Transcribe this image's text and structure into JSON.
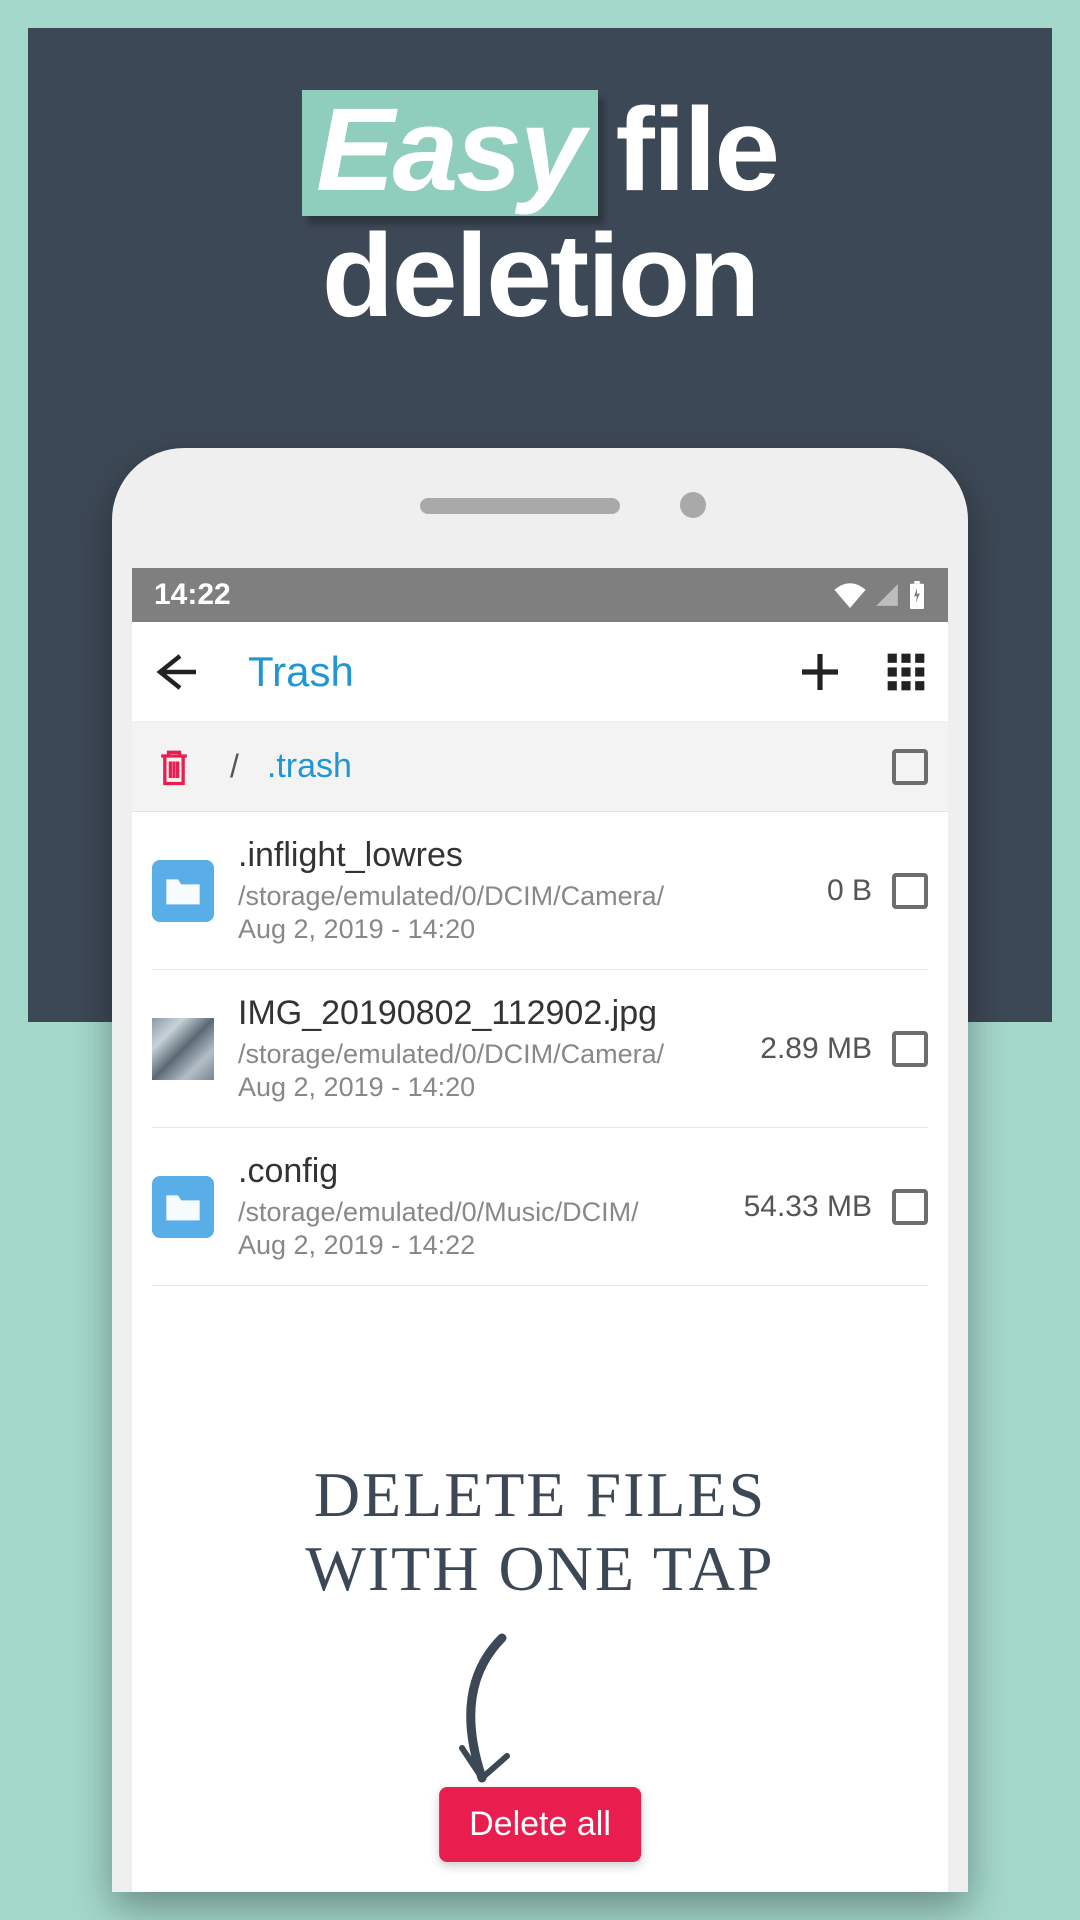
{
  "promo": {
    "headline_easy": "Easy",
    "headline_file": "file",
    "headline_deletion": "deletion",
    "callout_line1": "DELETE FILES",
    "callout_line2": "WITH ONE TAP"
  },
  "status": {
    "time": "14:22"
  },
  "appbar": {
    "title": "Trash"
  },
  "breadcrumb": {
    "separator": "/",
    "folder": ".trash"
  },
  "files": [
    {
      "name": ".inflight_lowres",
      "path": "/storage/emulated/0/DCIM/Camera/",
      "date": "Aug 2, 2019 - 14:20",
      "size": "0 B",
      "icon": "folder"
    },
    {
      "name": "IMG_20190802_112902.jpg",
      "path": "/storage/emulated/0/DCIM/Camera/",
      "date": "Aug 2, 2019 - 14:20",
      "size": "2.89 MB",
      "icon": "thumb"
    },
    {
      "name": ".config",
      "path": "/storage/emulated/0/Music/DCIM/",
      "date": "Aug 2, 2019 - 14:22",
      "size": "54.33 MB",
      "icon": "folder"
    }
  ],
  "delete_button": "Delete all"
}
